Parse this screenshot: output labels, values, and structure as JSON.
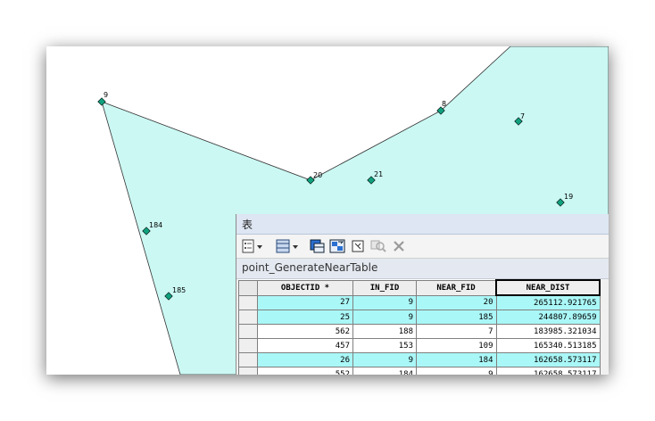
{
  "map": {
    "points": [
      {
        "id": "9"
      },
      {
        "id": "20"
      },
      {
        "id": "8"
      },
      {
        "id": "7"
      },
      {
        "id": "21"
      },
      {
        "id": "19"
      },
      {
        "id": "184"
      },
      {
        "id": "185"
      }
    ],
    "colors": {
      "polygon_fill": "#cbf8f3",
      "point_fill": "#0fa07d"
    }
  },
  "table_window": {
    "title": "表",
    "table_name": "point_GenerateNearTable",
    "toolbar_icons": [
      "table-options-icon",
      "related-tables-icon",
      "select-by-attributes-icon",
      "switch-selection-icon",
      "clear-selection-icon",
      "zoom-to-selected-icon",
      "delete-selected-icon"
    ],
    "columns": [
      "OBJECTID *",
      "IN_FID",
      "NEAR_FID",
      "NEAR_DIST"
    ],
    "rows": [
      {
        "objectid": "27",
        "in_fid": "9",
        "near_fid": "20",
        "near_dist": "265112.921765",
        "highlighted": true
      },
      {
        "objectid": "25",
        "in_fid": "9",
        "near_fid": "185",
        "near_dist": "244807.89659",
        "highlighted": true
      },
      {
        "objectid": "562",
        "in_fid": "188",
        "near_fid": "7",
        "near_dist": "183985.321034",
        "highlighted": false
      },
      {
        "objectid": "457",
        "in_fid": "153",
        "near_fid": "109",
        "near_dist": "165340.513185",
        "highlighted": false
      },
      {
        "objectid": "26",
        "in_fid": "9",
        "near_fid": "184",
        "near_dist": "162658.573117",
        "highlighted": true
      },
      {
        "objectid": "552",
        "in_fid": "184",
        "near_fid": "9",
        "near_dist": "162658.573117",
        "highlighted": false
      }
    ]
  }
}
